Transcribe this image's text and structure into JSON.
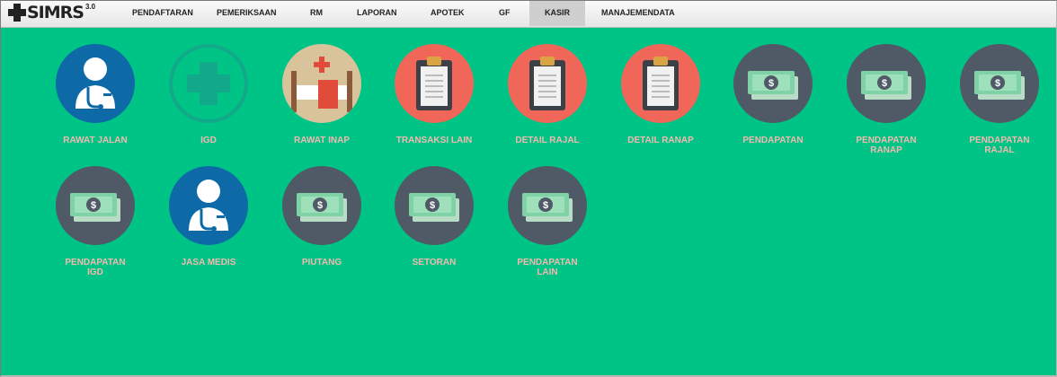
{
  "app": {
    "logo_text": "SIMRS",
    "logo_version": "3.0"
  },
  "nav": {
    "items": [
      {
        "label": "PENDAFTARAN"
      },
      {
        "label": "PEMERIKSAAN"
      },
      {
        "label": "RM"
      },
      {
        "label": "LAPORAN"
      },
      {
        "label": "APOTEK"
      },
      {
        "label": "GF"
      },
      {
        "label": "KASIR",
        "active": true
      },
      {
        "label": "MANAJEMENDATA"
      }
    ]
  },
  "tiles": [
    {
      "label": "RAWAT JALAN",
      "icon": "doctor-icon"
    },
    {
      "label": "IGD",
      "icon": "medical-cross-icon"
    },
    {
      "label": "RAWAT INAP",
      "icon": "hospital-bed-icon"
    },
    {
      "label": "TRANSAKSI LAIN",
      "icon": "clipboard-icon"
    },
    {
      "label": "DETAIL RAJAL",
      "icon": "clipboard-icon"
    },
    {
      "label": "DETAIL RANAP",
      "icon": "clipboard-icon"
    },
    {
      "label": "PENDAPATAN",
      "icon": "money-icon"
    },
    {
      "label": "PENDAPATAN\nRANAP",
      "icon": "money-icon"
    },
    {
      "label": "PENDAPATAN\nRAJAL",
      "icon": "money-icon"
    },
    {
      "label": "PENDAPATAN\nIGD",
      "icon": "money-icon"
    },
    {
      "label": "JASA MEDIS",
      "icon": "doctor-icon"
    },
    {
      "label": "PIUTANG",
      "icon": "money-icon"
    },
    {
      "label": "SETORAN",
      "icon": "money-icon"
    },
    {
      "label": "PENDAPATAN\nLAIN",
      "icon": "money-icon"
    }
  ],
  "colors": {
    "background": "#00c386",
    "label": "#f3b9b0",
    "doctor_circle": "#0e6aa6",
    "clipboard_circle": "#f0675a",
    "money_circle": "#4f5a66"
  }
}
